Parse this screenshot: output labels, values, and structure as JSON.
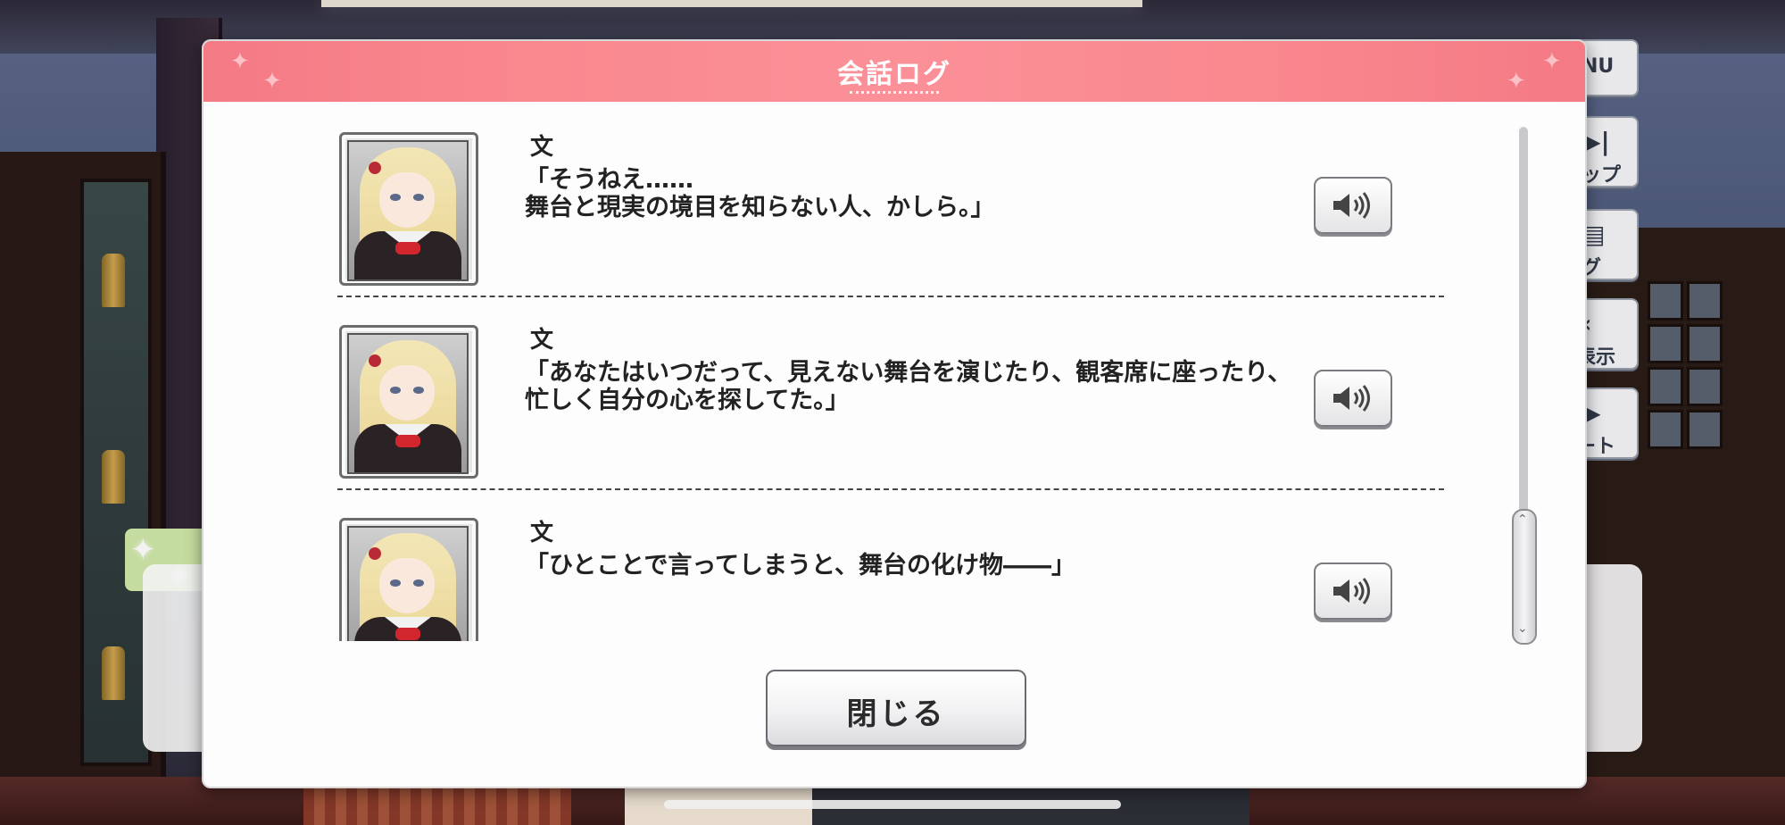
{
  "dialog": {
    "title": "会話ログ",
    "close_label": "閉じる"
  },
  "log_entries": [
    {
      "speaker": "文",
      "text": "「そうねえ……\n舞台と現実の境目を知らない人、かしら。」"
    },
    {
      "speaker": "文",
      "text": "「あなたはいつだって、見えない舞台を演じたり、観客席に座ったり、\n忙しく自分の心を探してた。」"
    },
    {
      "speaker": "文",
      "text": "「ひとことで言ってしまうと、舞台の化け物――」"
    }
  ],
  "side_menu": {
    "menu_label": "NU",
    "skip_label": "ップ",
    "log_label": "グ",
    "hide_label": "表示",
    "auto_label": "ート"
  },
  "colors": {
    "header_accent": "#f9868d",
    "portrait_bow": "#d2262e"
  },
  "icons": {
    "voice": "speaker-icon",
    "skip": "skip-icon",
    "log": "log-icon",
    "hide": "chevron-left-icon",
    "auto": "play-icon"
  }
}
